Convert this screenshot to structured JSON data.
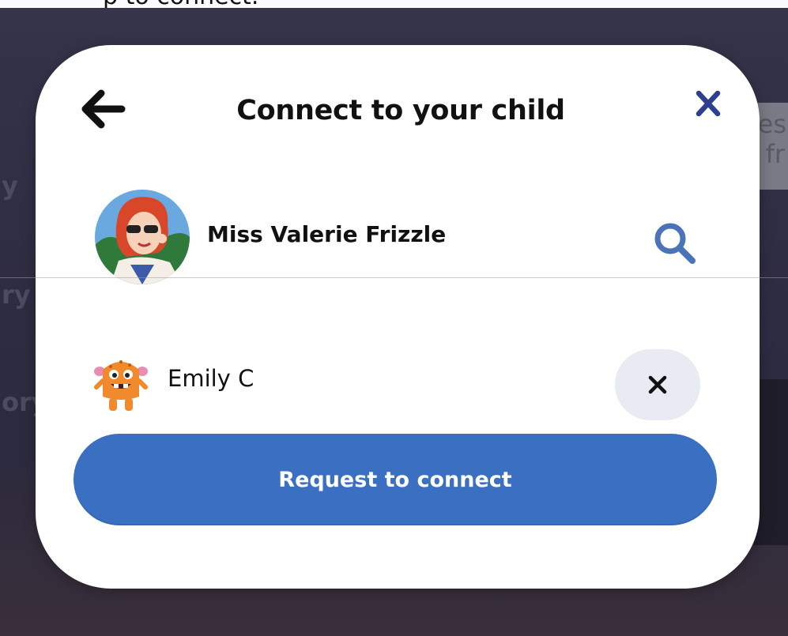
{
  "background": {
    "top_cut_text": "p to connect.",
    "left_fragments": [
      "y",
      "ry",
      "ory"
    ],
    "right_fragments": [
      "es",
      "fr"
    ]
  },
  "modal": {
    "title": "Connect to your child",
    "back_icon": "arrow-left-icon",
    "close_icon": "close-icon"
  },
  "teacher": {
    "name": "Miss Valerie Frizzle",
    "avatar_icon": "teacher-avatar",
    "action_icon": "search-icon"
  },
  "child": {
    "name": "Emily C",
    "avatar_icon": "monster-avatar",
    "remove_icon": "close-icon"
  },
  "actions": {
    "request_label": "Request to connect"
  },
  "colors": {
    "primary": "#3b6fc2",
    "close_icon": "#2f3f8f",
    "search_icon": "#4a73b8",
    "remove_button_bg": "#e9ebf2"
  }
}
